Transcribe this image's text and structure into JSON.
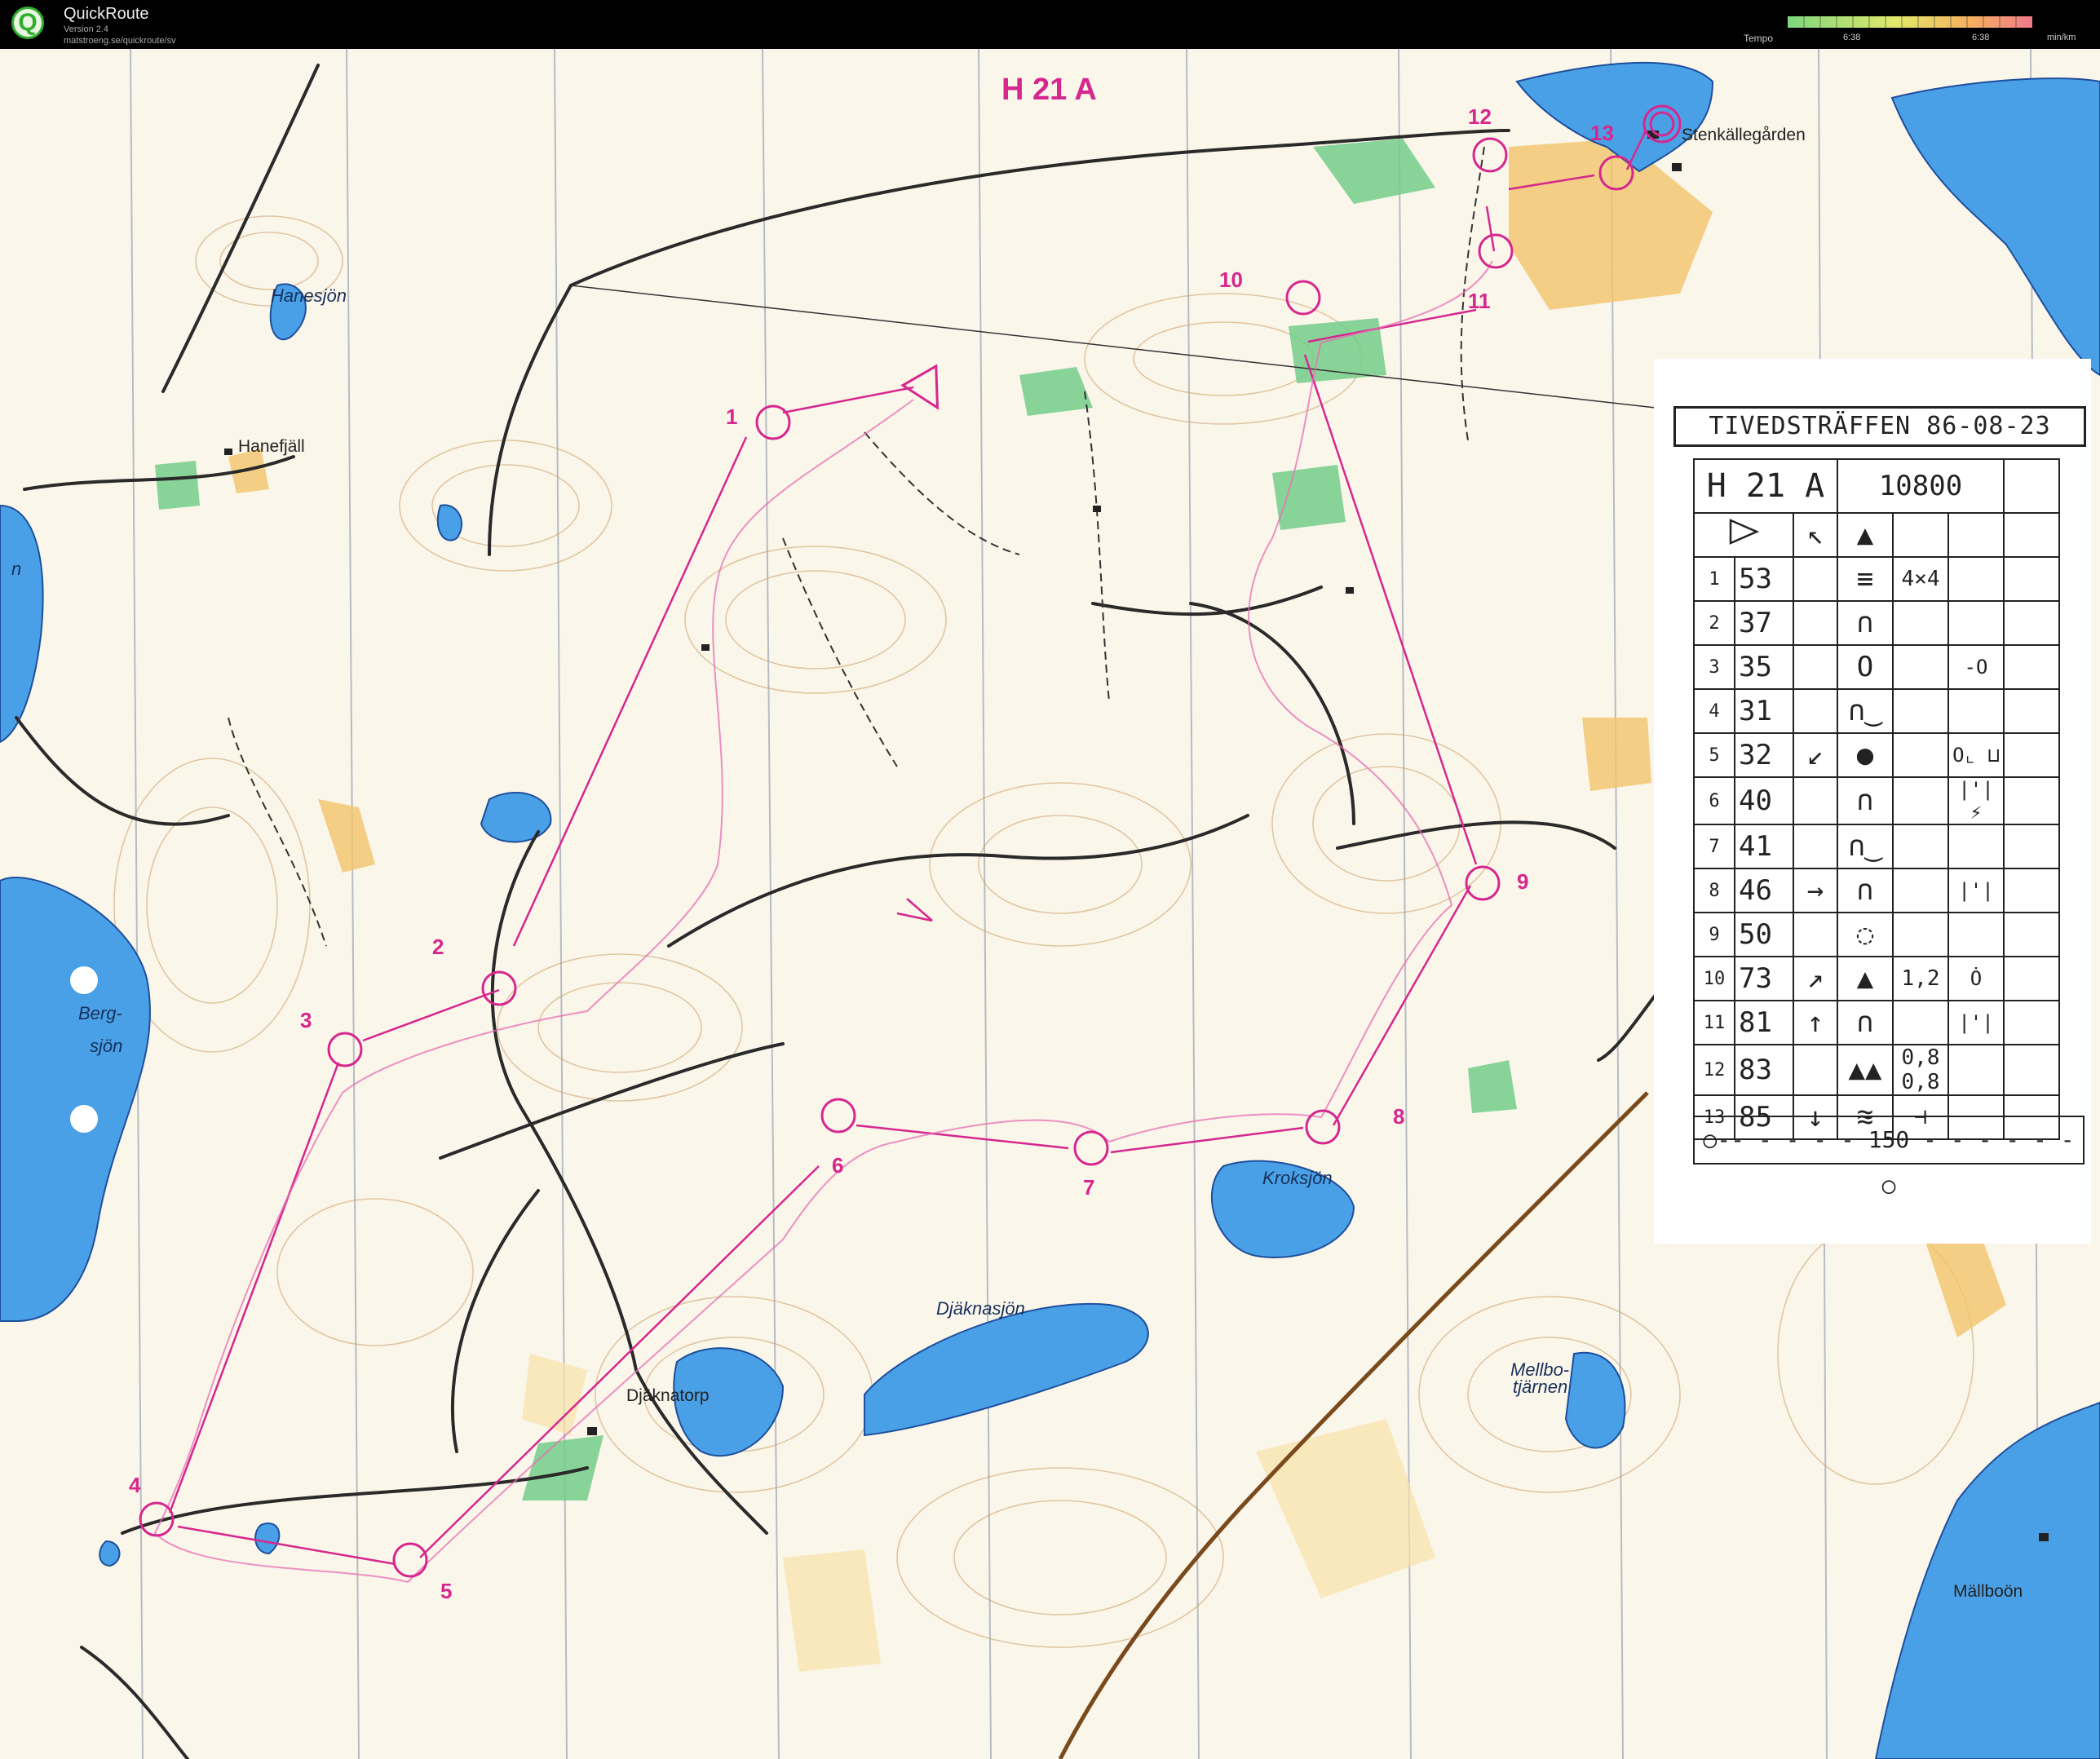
{
  "app": {
    "title": "QuickRoute",
    "version": "Version 2.4",
    "url": "matstroeng.se/quickroute/sv",
    "tempo_label": "Tempo",
    "tempo_low": "6:38",
    "tempo_high": "6:38",
    "tempo_unit": "min/km"
  },
  "map": {
    "class_label": "H 21 A",
    "places": {
      "hanesjon": "Hanesjön",
      "hanefjall": "Hanefjäll",
      "bergsjon_1": "Berg-",
      "bergsjon_2": "sjön",
      "sjon_edge": "n",
      "stenkallegarden": "Stenkällegården",
      "kroksjon": "Kroksjön",
      "djaknasjon": "Djäknasjön",
      "djaknatorp": "Djäknatorp",
      "mellbo_1": "Mellbo-",
      "mellbo_2": "tjärnen",
      "mallboon": "Mällboön"
    },
    "controls": [
      "1",
      "2",
      "3",
      "4",
      "5",
      "6",
      "7",
      "8",
      "9",
      "10",
      "11",
      "12",
      "13"
    ]
  },
  "card": {
    "title": "TIVEDSTRÄFFEN 86-08-23",
    "class": "H 21 A",
    "length": "10800",
    "rows": [
      {
        "n": "1",
        "code": "53",
        "dir": "",
        "sym": "≡",
        "extra": "4×4",
        "dim": ""
      },
      {
        "n": "2",
        "code": "37",
        "dir": "",
        "sym": "∩",
        "extra": "",
        "dim": ""
      },
      {
        "n": "3",
        "code": "35",
        "dir": "",
        "sym": "O",
        "extra": "",
        "dim": "-O"
      },
      {
        "n": "4",
        "code": "31",
        "dir": "",
        "sym": "∩‿",
        "extra": "",
        "dim": ""
      },
      {
        "n": "5",
        "code": "32",
        "dir": "↙",
        "sym": "●",
        "extra": "",
        "dim": "O⌞ ⊔"
      },
      {
        "n": "6",
        "code": "40",
        "dir": "",
        "sym": "∩",
        "extra": "",
        "dim": "|'| ⚡"
      },
      {
        "n": "7",
        "code": "41",
        "dir": "",
        "sym": "∩‿",
        "extra": "",
        "dim": ""
      },
      {
        "n": "8",
        "code": "46",
        "dir": "→",
        "sym": "∩",
        "extra": "",
        "dim": "|'|"
      },
      {
        "n": "9",
        "code": "50",
        "dir": "",
        "sym": "◌",
        "extra": "",
        "dim": ""
      },
      {
        "n": "10",
        "code": "73",
        "dir": "↗",
        "sym": "▲",
        "extra": "1,2",
        "dim": "Ȯ"
      },
      {
        "n": "11",
        "code": "81",
        "dir": "↑",
        "sym": "∩",
        "extra": "",
        "dim": "|'|"
      },
      {
        "n": "12",
        "code": "83",
        "dir": "",
        "sym": "▲▲",
        "extra": "0,8 0,8",
        "dim": ""
      },
      {
        "n": "13",
        "code": "85",
        "dir": "↓",
        "sym": "≋",
        "extra": "⊣",
        "dim": ""
      }
    ],
    "finish": "○-- - - - - 150 - - - - - - ○"
  }
}
